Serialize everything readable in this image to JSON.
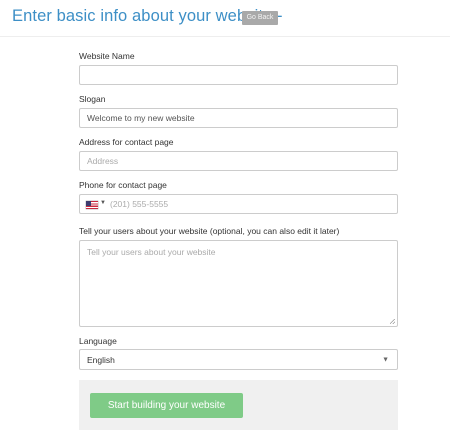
{
  "header": {
    "title": "Enter basic info about your website -",
    "back_label": "Go Back"
  },
  "form": {
    "website_name": {
      "label": "Website Name",
      "value": ""
    },
    "slogan": {
      "label": "Slogan",
      "value": "Welcome to my new website"
    },
    "address": {
      "label": "Address for contact page",
      "placeholder": "Address"
    },
    "phone": {
      "label": "Phone for contact page",
      "placeholder": "(201) 555-5555",
      "country": "us-flag-icon"
    },
    "about": {
      "label": "Tell your users about your website (optional, you can also edit it later)",
      "placeholder": "Tell your users about your website"
    },
    "language": {
      "label": "Language",
      "selected": "English"
    }
  },
  "submit": {
    "label": "Start building your website"
  },
  "colors": {
    "title": "#3d8fc6",
    "back_button": "#a9a9a9",
    "submit_button": "#7fcb87",
    "footer_panel": "#f0f0f0"
  }
}
